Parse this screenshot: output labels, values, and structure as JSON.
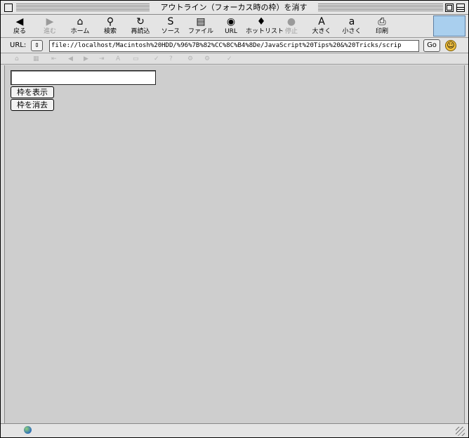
{
  "window": {
    "title": "アウトライン（フォーカス時の枠）を消す"
  },
  "toolbar": {
    "buttons": [
      {
        "label": "戻る",
        "icon": "back-arrow-icon",
        "glyph": "◀",
        "enabled": true
      },
      {
        "label": "進む",
        "icon": "forward-arrow-icon",
        "glyph": "▶",
        "enabled": false
      },
      {
        "label": "ホーム",
        "icon": "home-icon",
        "glyph": "⌂",
        "enabled": true
      },
      {
        "label": "検索",
        "icon": "search-icon",
        "glyph": "⚲",
        "enabled": true
      },
      {
        "label": "再読込",
        "icon": "reload-icon",
        "glyph": "↻",
        "enabled": true
      },
      {
        "label": "ソース",
        "icon": "source-icon",
        "glyph": "S",
        "enabled": true
      },
      {
        "label": "ファイル",
        "icon": "file-icon",
        "glyph": "▤",
        "enabled": true
      },
      {
        "label": "URL",
        "icon": "url-icon",
        "glyph": "◉",
        "enabled": true
      },
      {
        "label": "ホットリスト",
        "icon": "hotlist-icon",
        "glyph": "♦",
        "enabled": true
      },
      {
        "label": "停止",
        "icon": "stop-icon",
        "glyph": "●",
        "enabled": false
      },
      {
        "label": "大きく",
        "icon": "bigger-text-icon",
        "glyph": "A",
        "enabled": true
      },
      {
        "label": "小さく",
        "icon": "smaller-text-icon",
        "glyph": "a",
        "enabled": true
      },
      {
        "label": "印刷",
        "icon": "print-icon",
        "glyph": "⎙",
        "enabled": true
      }
    ]
  },
  "address_bar": {
    "label": "URL:",
    "stepper": "⇕",
    "url": "file://localhost/Macintosh%20HDD/%96%7B%82%CC%8C%B4%8De/JavaScript%20Tips%20&%20Tricks/scrip",
    "go_label": "Go",
    "smiley": "☺"
  },
  "iconbar": {
    "glyphs": [
      "⌂",
      "▦",
      "⇤",
      "◀",
      "▶",
      "⇥",
      "A",
      "▭",
      "✓",
      "?",
      "⚙",
      "⚙",
      "✓"
    ]
  },
  "page": {
    "text_field_value": "",
    "show_button_label": "枠を表示",
    "hide_button_label": "枠を消去"
  },
  "colors": {
    "content_bg": "#cecece",
    "chrome_bg": "#e4e4e4"
  }
}
